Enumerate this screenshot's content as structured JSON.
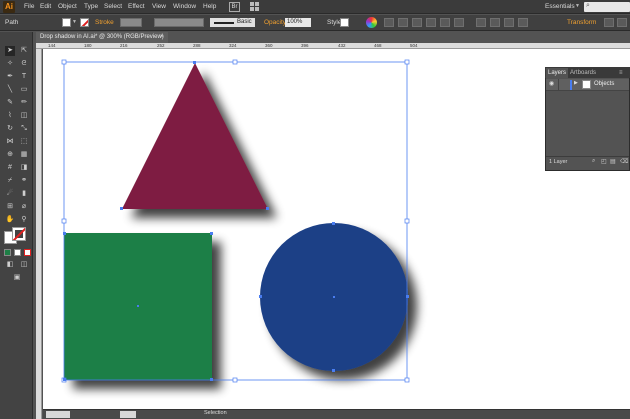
{
  "app": {
    "logo": "Ai"
  },
  "menu": {
    "items": [
      "File",
      "Edit",
      "Object",
      "Type",
      "Select",
      "Effect",
      "View",
      "Window",
      "Help"
    ],
    "bridge": "Br"
  },
  "workspace": {
    "label": "Essentials"
  },
  "control_bar": {
    "selection_type": "Path",
    "stroke_label": "Stroke",
    "brush_label": "Basic",
    "opacity_label": "Opacity",
    "opacity_value": "100%",
    "style_label": "Style:",
    "transform_label": "Transform"
  },
  "document": {
    "tab_title": "Drop shadow in AI.ai* @ 300% (RGB/Preview)",
    "close": "×"
  },
  "ruler": {
    "labels": [
      "144",
      "180",
      "216",
      "252",
      "288",
      "324",
      "360",
      "396",
      "432",
      "468",
      "504"
    ]
  },
  "shapes": {
    "triangle_color": "#7e1f42",
    "square_color": "#1e7f46",
    "circle_color": "#1c3f86",
    "selection_color": "#4a7df0",
    "effect": "drop shadow"
  },
  "layers_panel": {
    "tabs": [
      "Layers",
      "Artboards"
    ],
    "layer_name": "Objects",
    "layer_color": "#4a7df0",
    "layer_count": "1 Layer"
  },
  "status_bar": {
    "text": "Selection"
  },
  "icons": {
    "eye": "eye-icon",
    "search": "search-icon",
    "panel_menu": "panel-menu-icon"
  }
}
